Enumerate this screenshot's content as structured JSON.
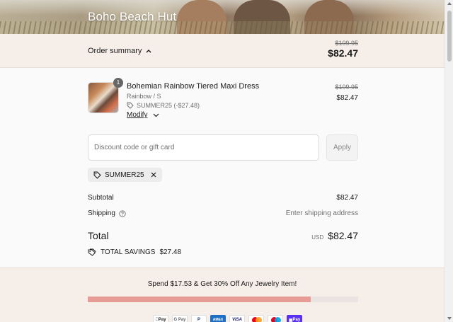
{
  "store": {
    "name": "Boho Beach Hut"
  },
  "summary": {
    "toggle_label": "Order summary",
    "original_total": "$109.95",
    "total": "$82.47"
  },
  "item": {
    "quantity": "1",
    "title": "Bohemian Rainbow Tiered Maxi Dress",
    "variant": "Rainbow / S",
    "discount": "SUMMER25 (-$27.48)",
    "modify_label": "Modify",
    "original_price": "$109.95",
    "price": "$82.47"
  },
  "discount_field": {
    "placeholder": "Discount code or gift card",
    "value": "",
    "apply_label": "Apply"
  },
  "applied_code": "SUMMER25",
  "totals": {
    "subtotal_label": "Subtotal",
    "subtotal_value": "$82.47",
    "shipping_label": "Shipping",
    "shipping_value": "Enter shipping address",
    "total_label": "Total",
    "currency": "USD",
    "total_value": "$82.47",
    "savings_label": "TOTAL SAVINGS",
    "savings_value": "$27.48"
  },
  "promo": {
    "text": "Spend $17.53 & Get 30% Off Any Jewelry Item!",
    "progress": 0.825
  },
  "payments": {
    "apple_pay": "Pay",
    "google_pay": "G Pay",
    "paypal": "P",
    "amex": "AMEX",
    "visa": "VISA",
    "shop_pay": "Pay"
  },
  "colors": {
    "summary_bg": "#f6eee8",
    "progress_fill": "#e79c95",
    "progress_track": "#e9e3e1",
    "text": "#1a1a1a",
    "muted": "#707070"
  }
}
